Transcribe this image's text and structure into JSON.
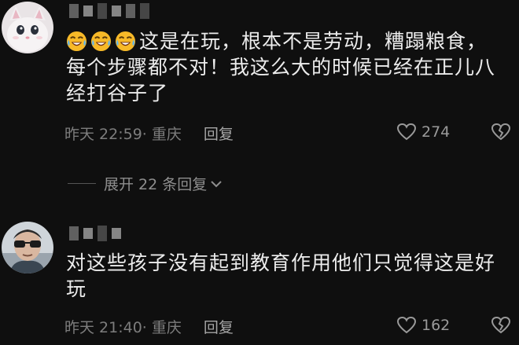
{
  "comments": [
    {
      "avatar": "cat-avatar",
      "text": "这是在玩，根本不是劳动，糟蹋粮食，每个步骤都不对！我这么大的时候已经在正儿八经打谷子了",
      "emoji": "laughing-crying-emoji",
      "emoji_count": 3,
      "time": "昨天 22:59",
      "location": "· 重庆",
      "reply_label": "回复",
      "likes": "274",
      "expand_label": "展开 22 条回复"
    },
    {
      "avatar": "man-sunglasses-avatar",
      "text": "对这些孩子没有起到教育作用他们只觉得这是好玩",
      "time": "昨天 21:40",
      "location": "· 重庆",
      "reply_label": "回复",
      "likes": "162"
    }
  ],
  "colors": {
    "background": "#0f0f0f",
    "text": "#ececec",
    "meta": "#7d7d7d",
    "emoji": "#f7b928"
  }
}
